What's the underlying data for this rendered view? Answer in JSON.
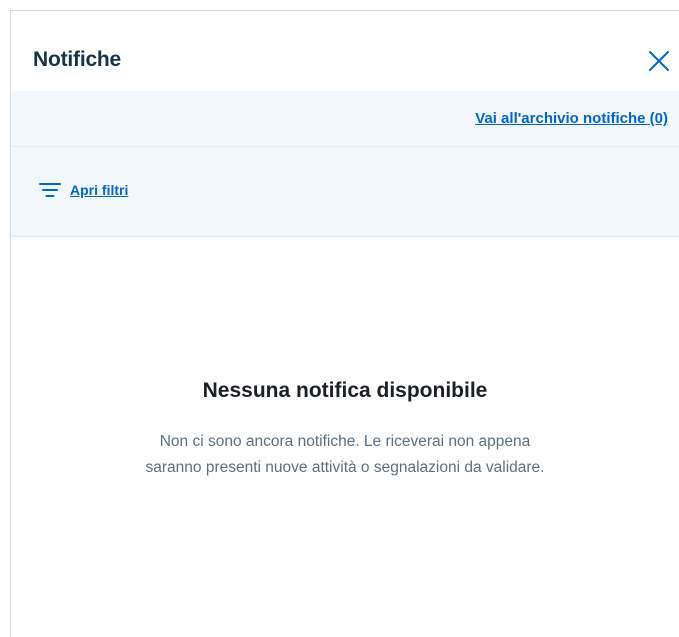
{
  "header": {
    "title": "Notifiche",
    "close_icon": "close-icon"
  },
  "archive": {
    "link_label": "Vai all'archivio notifiche (0)"
  },
  "filters": {
    "icon": "filter-icon",
    "label": "Apri filtri"
  },
  "empty_state": {
    "title": "Nessuna notifica disponibile",
    "message": "Non ci sono ancora notifiche. Le riceverai non appena saranno presenti nuove attività o segnalazioni da validare."
  },
  "colors": {
    "accent": "#0066cc",
    "title": "#17324d",
    "band_background": "#f2f7fc",
    "muted_text": "#5c6f82"
  }
}
